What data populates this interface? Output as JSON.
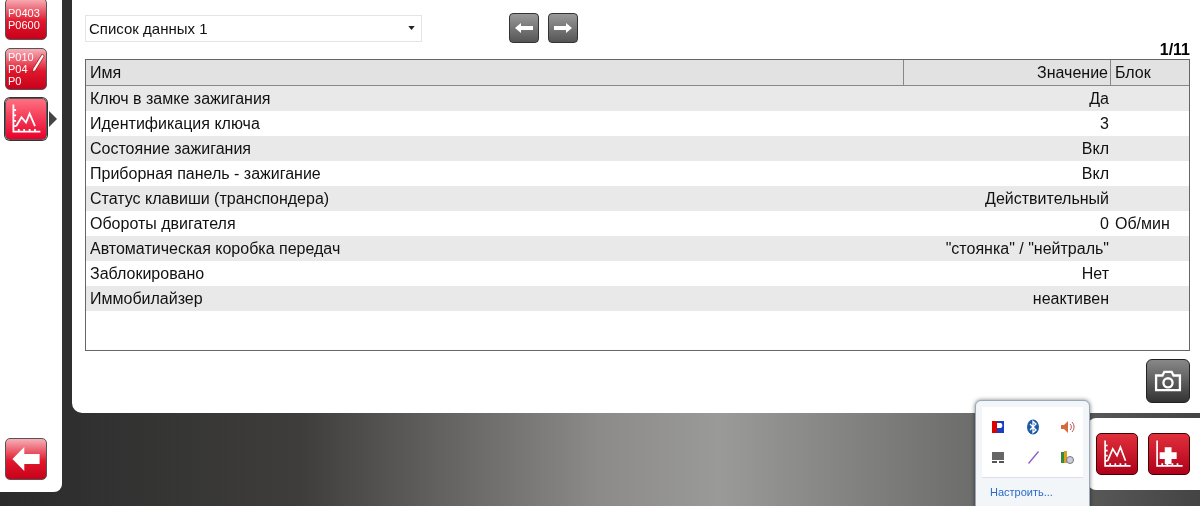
{
  "sidebar": {
    "items": [
      {
        "kind": "codes",
        "codes": [
          "P0403",
          "P0600"
        ],
        "selected": false
      },
      {
        "kind": "codes-edit",
        "codes": [
          "P010",
          "P04",
          "P0"
        ],
        "selected": false
      },
      {
        "kind": "graph",
        "selected": true
      }
    ]
  },
  "list_select": {
    "value": "Список данных 1"
  },
  "page_indicator": "1/11",
  "table": {
    "columns": [
      "Имя",
      "Значение",
      "Блок"
    ],
    "rows": [
      {
        "name": "Ключ в замке зажигания",
        "value": "Да"
      },
      {
        "name": "Идентификация ключа",
        "value": "3"
      },
      {
        "name": "Состояние зажигания",
        "value": "Вкл"
      },
      {
        "name": "Приборная панель - зажигание",
        "value": "Вкл"
      },
      {
        "name": "Статус клавиши (транспондера)",
        "value": "Действительный"
      },
      {
        "name": "Обороты двигателя",
        "value": "0",
        "unit": "Об/мин"
      },
      {
        "name": "Автоматическая коробка передач",
        "value": "\"стоянка\" / \"нейтраль\""
      },
      {
        "name": "Заблокировано",
        "value": "Нет"
      },
      {
        "name": "Иммобилайзер",
        "value": "неактивен"
      }
    ]
  },
  "tray": {
    "customize_link": "Настроить..."
  },
  "bottom_tools": [
    {
      "kind": "graph"
    },
    {
      "kind": "medical"
    }
  ]
}
